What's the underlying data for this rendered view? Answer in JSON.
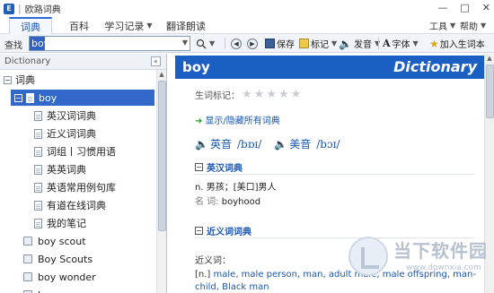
{
  "titlebar": {
    "icon_text": "E",
    "title": "欧路词典",
    "minimize": "—",
    "maximize": "□",
    "close": "✕"
  },
  "menu": {
    "tabs": [
      {
        "label": "词典",
        "active": true
      },
      {
        "label": "百科",
        "active": false
      },
      {
        "label": "学习记录",
        "has_dropdown": true
      },
      {
        "label": "翻译朗读",
        "active": false
      }
    ],
    "tools": "工具",
    "help": "帮助"
  },
  "toolbar": {
    "search_label": "查找",
    "search_value": "boy",
    "save": "保存",
    "mark": "标记",
    "speak": "发音",
    "font": "字体",
    "add_vocab": "加入生词本"
  },
  "sidebar": {
    "header": "Dictionary",
    "collapse": "«",
    "root": "词典",
    "selected_word": "boy",
    "sub_items": [
      "英汉词词典",
      "近义词词典",
      "词组丨习惯用语",
      "英英词典",
      "英语常用例句库",
      "有道在线词典",
      "我的笔记"
    ],
    "words": [
      "boy scout",
      "Boy Scouts",
      "boy wonder",
      "boyar"
    ]
  },
  "main": {
    "word": "boy",
    "header_right": "Dictionary",
    "rating_label": "生词标记：",
    "stars": 5,
    "toggle_all": "显示/隐藏所有词典",
    "pron_uk_label": "英音",
    "pron_uk": "/bɒɪ/",
    "pron_us_label": "美音",
    "pron_us": "/bɔɪ/",
    "section1": "英汉词典",
    "def1_pos": "n.",
    "def1_text": "男孩；[美口]男人",
    "def1_name_label": "名 词:",
    "def1_name_value": "boyhood",
    "section2": "近义词词典",
    "syn_label": "近义词：",
    "syn_pos": "[n.]",
    "syn_words": "male, male person, man, adult male, male offspring, man-child, Black man"
  },
  "watermark": {
    "title": "当下软件园",
    "url": "www.downxia.com"
  },
  "colors": {
    "accent": "#1a5fc1",
    "selection": "#3168c9",
    "link": "#1a56b0"
  }
}
